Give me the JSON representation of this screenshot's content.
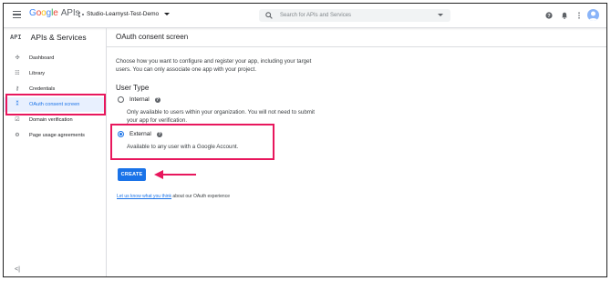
{
  "topbar": {
    "logo_google": "Google",
    "logo_apis": "APIs",
    "project_name": "Studio-Learnyst-Test-Demo",
    "search_placeholder": "Search for APIs and Services"
  },
  "sidebar": {
    "api_badge": "API",
    "title": "APIs & Services",
    "items": [
      {
        "label": "Dashboard",
        "icon": "dashboard-icon"
      },
      {
        "label": "Library",
        "icon": "library-icon"
      },
      {
        "label": "Credentials",
        "icon": "key-icon"
      },
      {
        "label": "OAuth consent screen",
        "icon": "consent-icon",
        "active": true
      },
      {
        "label": "Domain verification",
        "icon": "checkbox-icon"
      },
      {
        "label": "Page usage agreements",
        "icon": "settings-list-icon"
      }
    ],
    "collapse_glyph": "<|"
  },
  "main": {
    "title": "OAuth consent screen",
    "intro": "Choose how you want to configure and register your app, including your target users. You can only associate one app with your project.",
    "user_type_label": "User Type",
    "internal_label": "Internal",
    "internal_desc": "Only available to users within your organization. You will not need to submit your app for verification.",
    "external_label": "External",
    "external_desc": "Available to any user with a Google Account.",
    "selected": "External",
    "create_label": "CREATE",
    "footer_link": "Let us know what you think",
    "footer_rest": " about our OAuth experience"
  },
  "colors": {
    "accent": "#1a73e8",
    "annotation": "#e8175d"
  }
}
